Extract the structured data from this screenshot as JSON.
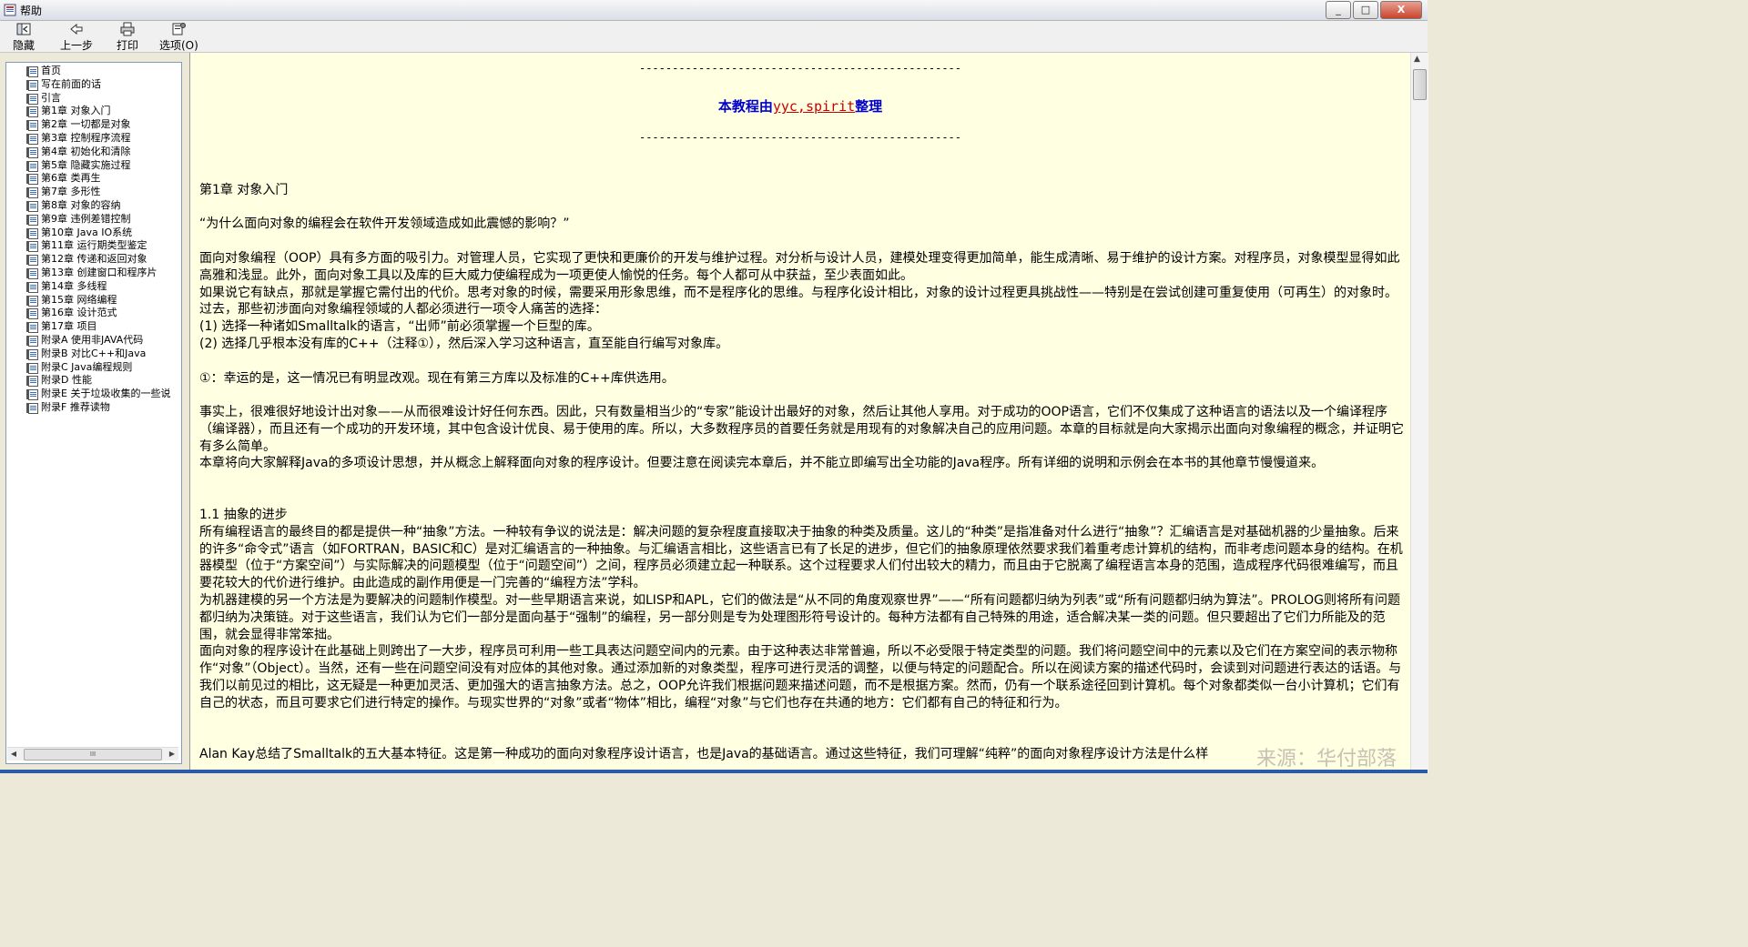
{
  "window": {
    "title": "帮助",
    "minimize": "_",
    "maximize": "□",
    "close": "X"
  },
  "toolbar": {
    "hide_label": "隐藏",
    "back_label": "上一步",
    "print_label": "打印",
    "options_label": "选项(O)"
  },
  "toc": {
    "items": [
      "首页",
      "写在前面的话",
      "引言",
      "第1章 对象入门",
      "第2章 一切都是对象",
      "第3章 控制程序流程",
      "第4章 初始化和清除",
      "第5章 隐藏实施过程",
      "第6章 类再生",
      "第7章 多形性",
      "第8章 对象的容纳",
      "第9章 违例差错控制",
      "第10章 Java IO系统",
      "第11章 运行期类型鉴定",
      "第12章 传递和返回对象",
      "第13章 创建窗口和程序片",
      "第14章 多线程",
      "第15章 网络编程",
      "第16章 设计范式",
      "第17章 项目",
      "附录A 使用非JAVA代码",
      "附录B 对比C++和Java",
      "附录C Java编程规则",
      "附录D 性能",
      "附录E 关于垃圾收集的一些说",
      "附录F 推荐读物"
    ],
    "scroll_grip": "III"
  },
  "content": {
    "rule": "-------------------------------------------------",
    "banner_pre": "本教程由",
    "banner_hl": "yyc,spirit",
    "banner_post": "整理",
    "chapter_title": "第1章 对象入门",
    "quote": "“为什么面向对象的编程会在软件开发领域造成如此震憾的影响？”",
    "p1": "面向对象编程（OOP）具有多方面的吸引力。对管理人员，它实现了更快和更廉价的开发与维护过程。对分析与设计人员，建模处理变得更加简单，能生成清晰、易于维护的设计方案。对程序员，对象模型显得如此高雅和浅显。此外，面向对象工具以及库的巨大威力使编程成为一项更使人愉悦的任务。每个人都可从中获益，至少表面如此。",
    "p2": "如果说它有缺点，那就是掌握它需付出的代价。思考对象的时候，需要采用形象思维，而不是程序化的思维。与程序化设计相比，对象的设计过程更具挑战性——特别是在尝试创建可重复使用（可再生）的对象时。过去，那些初涉面向对象编程领域的人都必须进行一项令人痛苦的选择：",
    "p3": "(1) 选择一种诸如Smalltalk的语言，“出师”前必须掌握一个巨型的库。",
    "p4": "(2) 选择几乎根本没有库的C++（注释①），然后深入学习这种语言，直至能自行编写对象库。",
    "note": "①：幸运的是，这一情况已有明显改观。现在有第三方库以及标准的C++库供选用。",
    "p5": "事实上，很难很好地设计出对象——从而很难设计好任何东西。因此，只有数量相当少的“专家”能设计出最好的对象，然后让其他人享用。对于成功的OOP语言，它们不仅集成了这种语言的语法以及一个编译程序（编译器），而且还有一个成功的开发环境，其中包含设计优良、易于使用的库。所以，大多数程序员的首要任务就是用现有的对象解决自己的应用问题。本章的目标就是向大家揭示出面向对象编程的概念，并证明它有多么简单。",
    "p6": "本章将向大家解释Java的多项设计思想，并从概念上解释面向对象的程序设计。但要注意在阅读完本章后，并不能立即编写出全功能的Java程序。所有详细的说明和示例会在本书的其他章节慢慢道来。",
    "section": "1.1 抽象的进步",
    "p7": "所有编程语言的最终目的都是提供一种“抽象”方法。一种较有争议的说法是：解决问题的复杂程度直接取决于抽象的种类及质量。这儿的“种类”是指准备对什么进行“抽象”？汇编语言是对基础机器的少量抽象。后来的许多“命令式”语言（如FORTRAN，BASIC和C）是对汇编语言的一种抽象。与汇编语言相比，这些语言已有了长足的进步，但它们的抽象原理依然要求我们着重考虑计算机的结构，而非考虑问题本身的结构。在机器模型（位于“方案空间”）与实际解决的问题模型（位于“问题空间”）之间，程序员必须建立起一种联系。这个过程要求人们付出较大的精力，而且由于它脱离了编程语言本身的范围，造成程序代码很难编写，而且要花较大的代价进行维护。由此造成的副作用便是一门完善的“编程方法”学科。",
    "p8": "为机器建模的另一个方法是为要解决的问题制作模型。对一些早期语言来说，如LISP和APL，它们的做法是“从不同的角度观察世界”——“所有问题都归纳为列表”或“所有问题都归纳为算法”。PROLOG则将所有问题都归纳为决策链。对于这些语言，我们认为它们一部分是面向基于“强制”的编程，另一部分则是专为处理图形符号设计的。每种方法都有自己特殊的用途，适合解决某一类的问题。但只要超出了它们力所能及的范围，就会显得非常笨拙。",
    "p9": "面向对象的程序设计在此基础上则跨出了一大步，程序员可利用一些工具表达问题空间内的元素。由于这种表达非常普遍，所以不必受限于特定类型的问题。我们将问题空间中的元素以及它们在方案空间的表示物称作“对象”（Object）。当然，还有一些在问题空间没有对应体的其他对象。通过添加新的对象类型，程序可进行灵活的调整，以便与特定的问题配合。所以在阅读方案的描述代码时，会读到对问题进行表达的话语。与我们以前见过的相比，这无疑是一种更加灵活、更加强大的语言抽象方法。总之，OOP允许我们根据问题来描述问题，而不是根据方案。然而，仍有一个联系途径回到计算机。每个对象都类似一台小计算机；它们有自己的状态，而且可要求它们进行特定的操作。与现实世界的“对象”或者“物体”相比，编程“对象”与它们也存在共通的地方：它们都有自己的特征和行为。",
    "p10": "Alan Kay总结了Smalltalk的五大基本特征。这是第一种成功的面向对象程序设计语言，也是Java的基础语言。通过这些特征，我们可理解“纯粹”的面向对象程序设计方法是什么样"
  },
  "watermark": "来源：华付部落"
}
